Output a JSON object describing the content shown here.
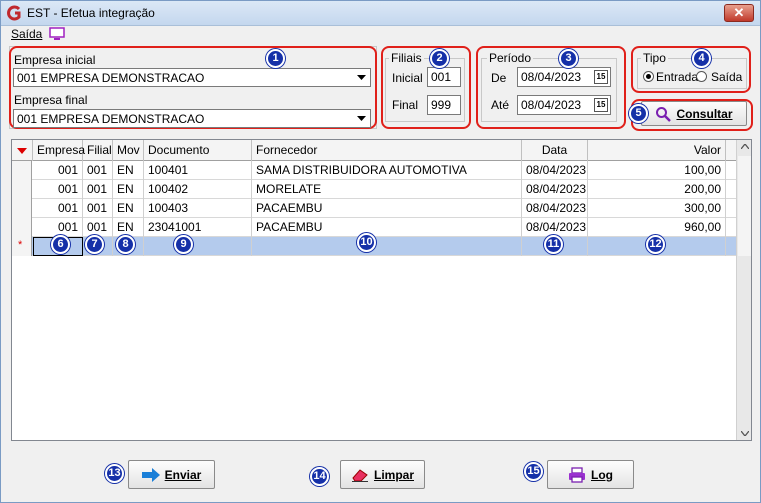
{
  "window": {
    "title": "EST - Efetua integração",
    "close_label": "✕"
  },
  "menu": {
    "saida": "Saída"
  },
  "empresa": {
    "inicial_label": "Empresa inicial",
    "inicial_value": "001 EMPRESA DEMONSTRACAO",
    "final_label": "Empresa final",
    "final_value": "001 EMPRESA DEMONSTRACAO"
  },
  "filiais": {
    "title": "Filiais",
    "inicial_label": "Inicial",
    "inicial_value": "001",
    "final_label": "Final",
    "final_value": "999"
  },
  "periodo": {
    "title": "Período",
    "de_label": "De",
    "de_value": "08/04/2023",
    "ate_label": "Até",
    "ate_value": "08/04/2023",
    "cal_label": "15"
  },
  "tipo": {
    "title": "Tipo",
    "entrada_label": "Entrada",
    "saida_label": "Saída",
    "selected": "Entrada"
  },
  "buttons": {
    "consultar": "Consultar",
    "enviar": "Enviar",
    "limpar": "Limpar",
    "log": "Log"
  },
  "badges": [
    "1",
    "2",
    "3",
    "4",
    "5",
    "6",
    "7",
    "8",
    "9",
    "10",
    "11",
    "12",
    "13",
    "14",
    "15"
  ],
  "grid": {
    "columns": [
      "Empresa",
      "Filial",
      "Mov",
      "Documento",
      "Fornecedor",
      "Data",
      "Valor"
    ],
    "rows": [
      [
        "001",
        "001",
        "EN",
        "100401",
        "SAMA DISTRIBUIDORA AUTOMOTIVA",
        "08/04/2023",
        "100,00"
      ],
      [
        "001",
        "001",
        "EN",
        "100402",
        "MORELATE",
        "08/04/2023",
        "200,00"
      ],
      [
        "001",
        "001",
        "EN",
        "100403",
        "PACAEMBU",
        "08/04/2023",
        "300,00"
      ],
      [
        "001",
        "001",
        "EN",
        "23041001",
        "PACAEMBU",
        "08/04/2023",
        "960,00"
      ]
    ],
    "new_row_marker": "*"
  },
  "colors": {
    "highlight_red": "#e0201a",
    "badge_blue": "#1530a8",
    "new_row": "#b4cbed"
  }
}
